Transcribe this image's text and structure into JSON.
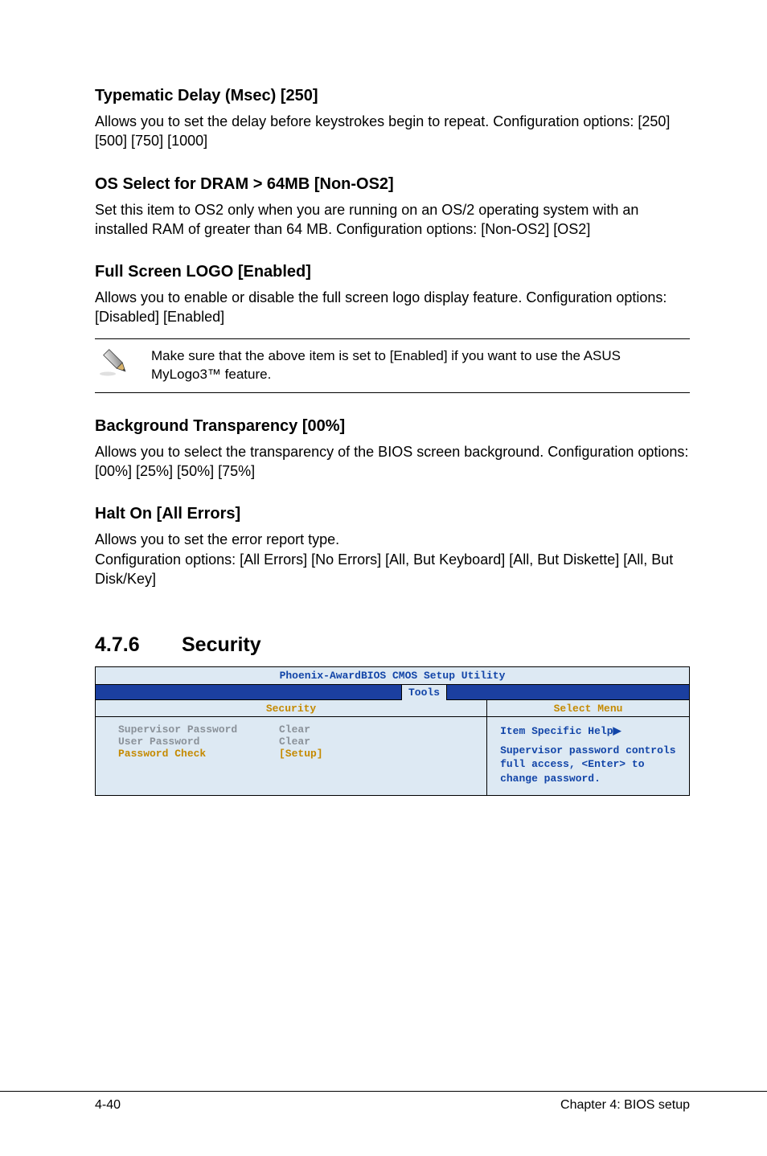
{
  "sections": {
    "s1": {
      "title": "Typematic Delay (Msec) [250]",
      "p": "Allows you to set the delay before keystrokes begin to repeat. Configuration options: [250] [500] [750] [1000]"
    },
    "s2": {
      "title": "OS Select for DRAM > 64MB [Non-OS2]",
      "p": "Set this item to OS2 only when you are running on an OS/2 operating system with an installed RAM of greater than 64 MB. Configuration options: [Non-OS2] [OS2]"
    },
    "s3": {
      "title": "Full Screen LOGO [Enabled]",
      "p": "Allows you to enable or disable the full screen logo display feature. Configuration options: [Disabled] [Enabled]"
    },
    "note": "Make sure that the above item is set to [Enabled] if you want to use the ASUS MyLogo3™ feature.",
    "s4": {
      "title": "Background Transparency [00%]",
      "p": "Allows you to select the transparency of the BIOS screen background. Configuration options: [00%] [25%] [50%] [75%]"
    },
    "s5": {
      "title": "Halt On [All Errors]",
      "p": "Allows you to set the error report type.\nConfiguration options: [All Errors] [No Errors] [All, But Keyboard] [All, But Diskette] [All, But Disk/Key]"
    }
  },
  "heading": {
    "num": "4.7.6",
    "title": "Security"
  },
  "bios": {
    "title": "Phoenix-AwardBIOS CMOS Setup Utility",
    "tab": "Tools",
    "left_header": "Security",
    "right_header": "Select Menu",
    "rows": [
      {
        "label": "Supervisor Password",
        "value": "Clear",
        "hl": false
      },
      {
        "label": "User Password",
        "value": "Clear",
        "hl": false
      },
      {
        "label": "Password Check",
        "value": "[Setup]",
        "hl": true
      }
    ],
    "help_title": "Item Specific Help",
    "help_body": "Supervisor password controls full access, <Enter> to change password."
  },
  "footer": {
    "left": "4-40",
    "right": "Chapter 4: BIOS setup"
  }
}
